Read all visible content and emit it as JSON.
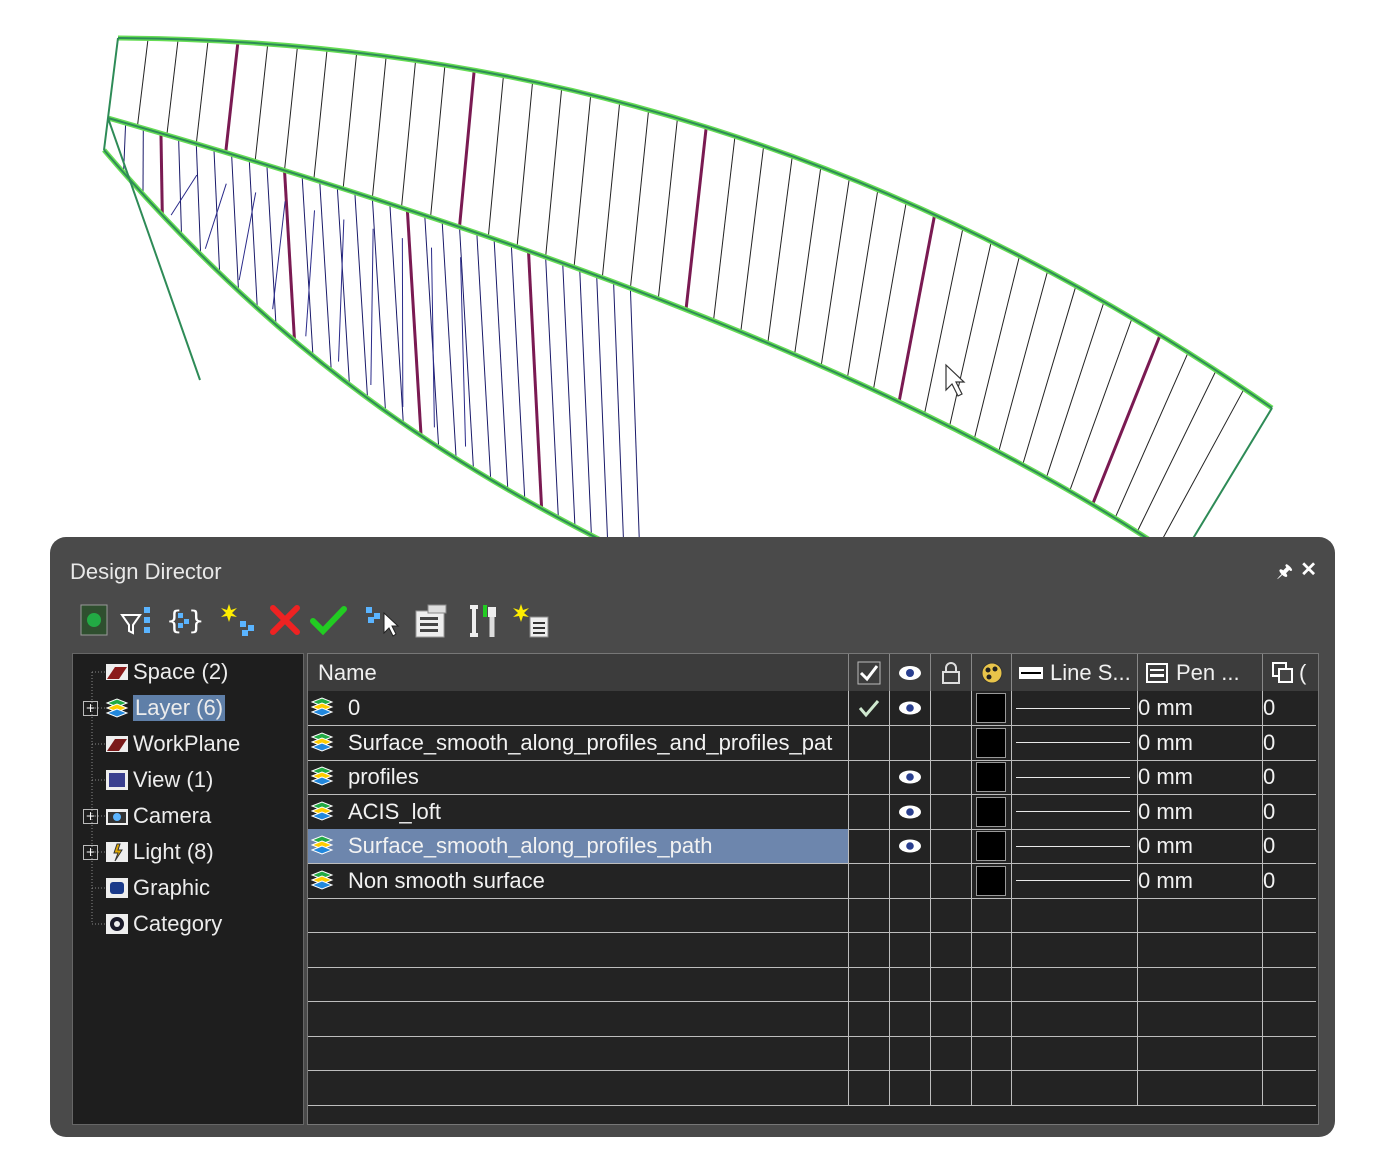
{
  "panel": {
    "title": "Design Director"
  },
  "toolbar": {
    "buttons": [
      {
        "name": "layer-toggle-icon"
      },
      {
        "name": "filter-icon"
      },
      {
        "name": "group-select-icon"
      },
      {
        "name": "new-layer-icon"
      },
      {
        "name": "delete-icon"
      },
      {
        "name": "set-active-icon"
      },
      {
        "name": "select-objects-icon"
      },
      {
        "name": "properties-icon"
      },
      {
        "name": "tools-icon"
      },
      {
        "name": "new-item-icon"
      }
    ]
  },
  "tree": {
    "items": [
      {
        "label": "Space (2)",
        "icon": "space-icon",
        "expandable": false
      },
      {
        "label": "Layer (6)",
        "icon": "layer-icon",
        "expandable": true,
        "selected": true
      },
      {
        "label": "WorkPlane",
        "icon": "workplane-icon",
        "expandable": false
      },
      {
        "label": "View (1)",
        "icon": "view-icon",
        "expandable": false
      },
      {
        "label": "Camera",
        "icon": "camera-icon",
        "expandable": true
      },
      {
        "label": "Light (8)",
        "icon": "light-icon",
        "expandable": true
      },
      {
        "label": "Graphic",
        "icon": "graphic-icon",
        "expandable": false
      },
      {
        "label": "Category",
        "icon": "category-icon",
        "expandable": false
      }
    ]
  },
  "grid": {
    "columns": {
      "name": "Name",
      "active": "active-check-icon",
      "visible": "eye-icon",
      "locked": "lock-icon",
      "color": "color-palette-icon",
      "linestyle": "Line S...",
      "pen": "Pen ...",
      "copy": "("
    },
    "rows": [
      {
        "name": "0",
        "active": true,
        "visible": true,
        "pen": "0 mm",
        "copy": "0"
      },
      {
        "name": "Surface_smooth_along_profiles_and_profiles_pat",
        "active": false,
        "visible": false,
        "pen": "0 mm",
        "copy": "0"
      },
      {
        "name": "profiles",
        "active": false,
        "visible": true,
        "pen": "0 mm",
        "copy": "0"
      },
      {
        "name": "ACIS_loft",
        "active": false,
        "visible": true,
        "pen": "0 mm",
        "copy": "0"
      },
      {
        "name": "Surface_smooth_along_profiles_path",
        "active": false,
        "visible": true,
        "pen": "0 mm",
        "copy": "0",
        "selected": true
      },
      {
        "name": "Non smooth surface",
        "active": false,
        "visible": false,
        "pen": "0 mm",
        "copy": "0"
      }
    ],
    "empty_rows": 6
  },
  "colors": {
    "hull_outline": "#2e8b57",
    "hull_outline_glow": "#66dd55",
    "profile_accent": "#7a1a52",
    "panel_bg": "#4a4a4a",
    "selection": "#6d86ad"
  }
}
